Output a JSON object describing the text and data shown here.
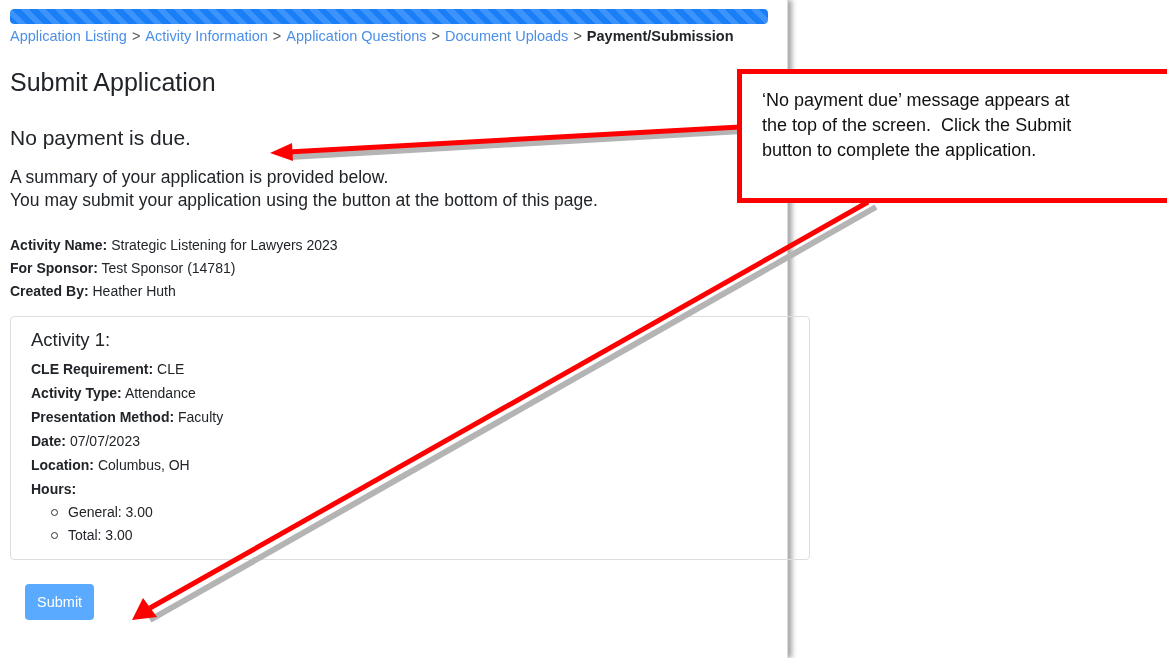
{
  "progress": {
    "level": 1
  },
  "breadcrumb": [
    {
      "label": "Application Listing",
      "current": false,
      "separator": ">"
    },
    {
      "label": "Activity Information",
      "current": false,
      "separator": ">"
    },
    {
      "label": "Application Questions",
      "current": false,
      "separator": ">"
    },
    {
      "label": "Document Uploads",
      "current": false,
      "separator": ">"
    },
    {
      "label": "Payment/Submission",
      "current": true
    }
  ],
  "title": "Submit Application",
  "notice": "No payment is due.",
  "intro": [
    "A summary of your application is provided below.",
    "You may submit your application using the button at the bottom of this page."
  ],
  "summary": [
    {
      "label": "Activity Name:",
      "value": "Strategic Listening for Lawyers 2023"
    },
    {
      "label": "For Sponsor:",
      "value": "Test Sponsor (14781)"
    },
    {
      "label": "Created By:",
      "value": "Heather Huth"
    }
  ],
  "activities": [
    {
      "title": "Activity 1:",
      "fields": [
        {
          "label": "CLE Requirement:",
          "value": "CLE"
        },
        {
          "label": "Activity Type:",
          "value": "Attendance"
        },
        {
          "label": "Presentation Method:",
          "value": "Faculty"
        },
        {
          "label": "Date:",
          "value": "07/07/2023"
        },
        {
          "label": "Location:",
          "value": "Columbus, OH"
        }
      ],
      "hours_label": "Hours:",
      "hours": [
        "General: 3.00",
        "Total: 3.00"
      ]
    }
  ],
  "submit_button": {
    "label": "Submit",
    "disabled": true
  },
  "callout": {
    "lines": [
      "‘No payment due’ message appears at",
      "the top of the screen.  Click the Submit",
      "button to complete the application."
    ]
  }
}
